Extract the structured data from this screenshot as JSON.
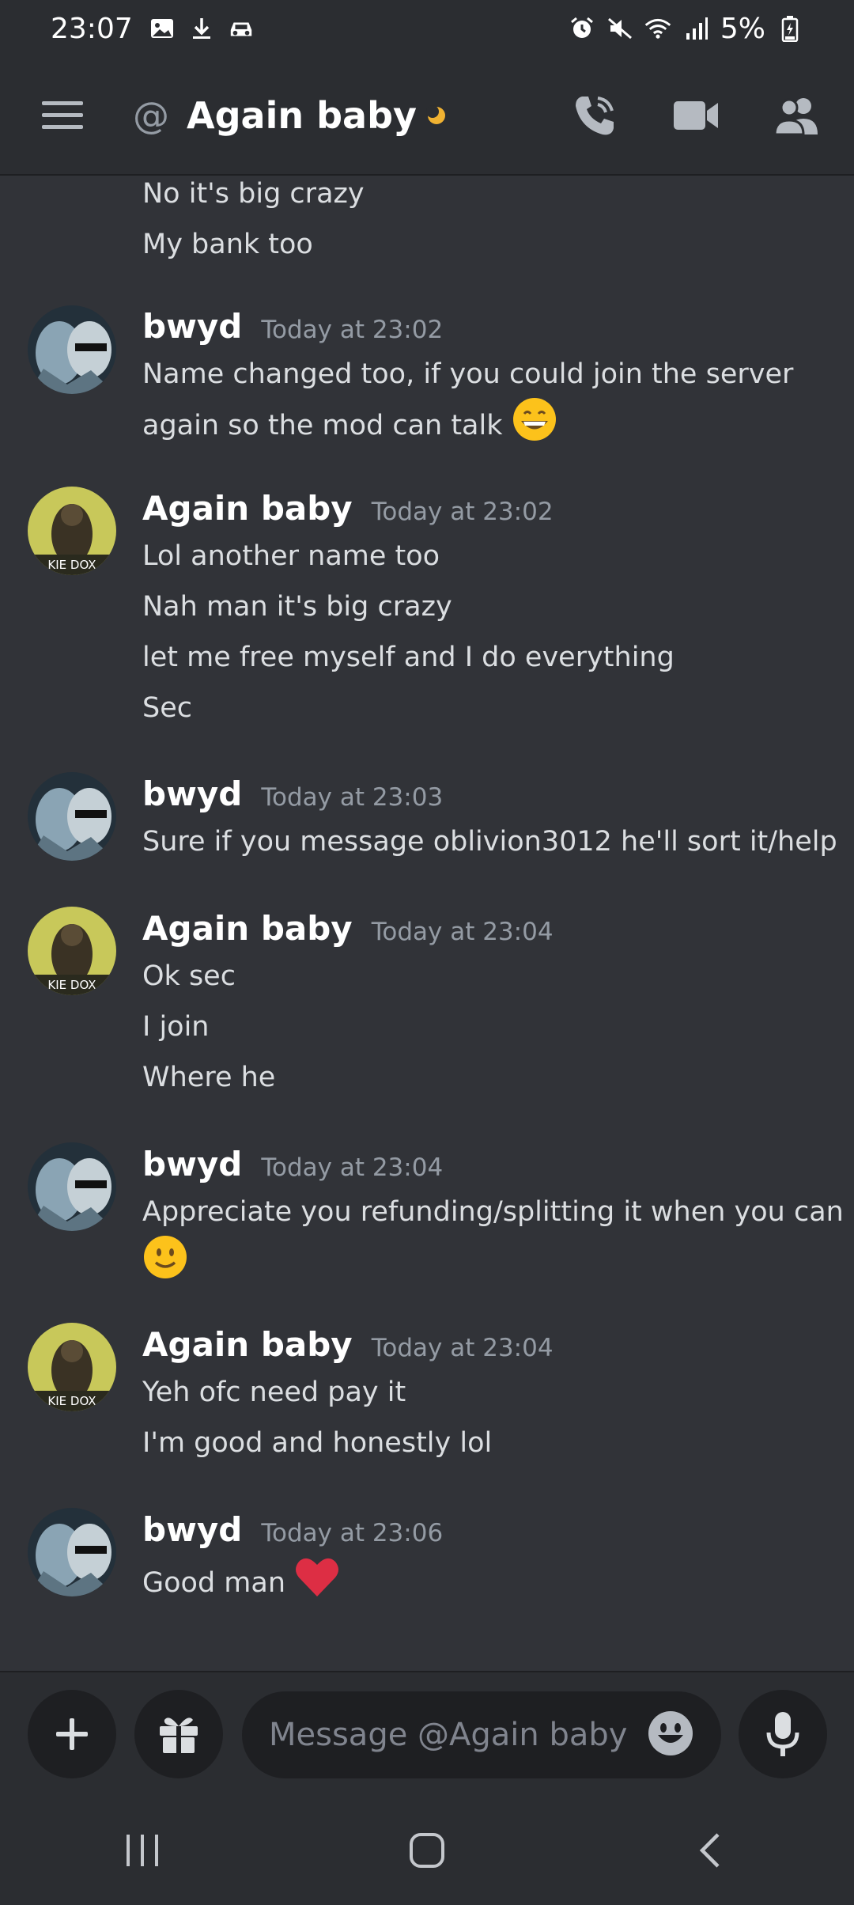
{
  "status_bar": {
    "time": "23:07",
    "battery": "5%",
    "icons": [
      "image-icon",
      "download-icon",
      "car-icon",
      "alarm-icon",
      "mute-icon",
      "wifi-icon",
      "signal-icon",
      "battery-icon"
    ]
  },
  "header": {
    "at_symbol": "@",
    "title": "Again baby",
    "status": "idle-moon-icon",
    "actions": [
      "phone-call-icon",
      "video-camera-icon",
      "members-icon"
    ]
  },
  "messages": {
    "continued": [
      "No it's big crazy",
      "My bank too"
    ],
    "groups": [
      {
        "author": "bwyd",
        "timestamp": "Today at 23:02",
        "lines": [
          "Name changed too, if you could join the server",
          "again so the mod can talk"
        ],
        "emoji": "grinning-face-icon"
      },
      {
        "author": "Again baby",
        "timestamp": "Today at 23:02",
        "lines": [
          "Lol another name too",
          "Nah man it's big crazy",
          "let me free myself and I do everything",
          "Sec"
        ]
      },
      {
        "author": "bwyd",
        "timestamp": "Today at 23:03",
        "lines": [
          "Sure if you message oblivion3012 he'll sort it/help"
        ]
      },
      {
        "author": "Again baby",
        "timestamp": "Today at 23:04",
        "lines": [
          "Ok sec",
          "I join",
          "Where he"
        ]
      },
      {
        "author": "bwyd",
        "timestamp": "Today at 23:04",
        "lines": [
          "Appreciate you refunding/splitting it when you can"
        ],
        "emoji": "slightly-smiling-face-icon"
      },
      {
        "author": "Again baby",
        "timestamp": "Today at 23:04",
        "lines": [
          "Yeh ofc need pay it",
          "I'm good and honestly lol"
        ]
      },
      {
        "author": "bwyd",
        "timestamp": "Today at 23:06",
        "lines": [
          "Good man"
        ],
        "emoji": "red-heart-icon"
      }
    ]
  },
  "avatars": {
    "again_baby_caption": "KIE DOX"
  },
  "composer": {
    "placeholder": "Message @Again baby",
    "buttons": [
      "plus-icon",
      "gift-icon",
      "emoji-icon",
      "microphone-icon"
    ]
  },
  "nav": [
    "recent-apps-icon",
    "home-icon",
    "back-icon"
  ],
  "colors": {
    "background": "#313338",
    "header": "#2b2d31",
    "input": "#1e1f22",
    "text": "#dbdee1",
    "muted": "#949ba4",
    "idle": "#f0b232",
    "heart": "#dd2e44"
  }
}
